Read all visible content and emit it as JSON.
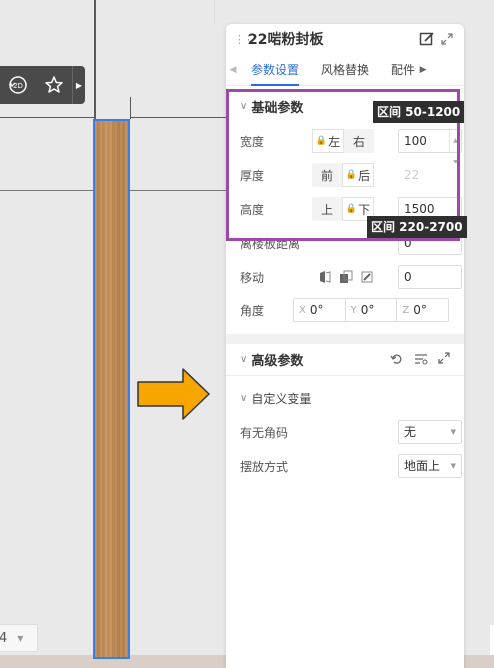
{
  "canvas": {
    "colors": {
      "board_outline": "#3a7ee8",
      "highlight_border": "#9b4aa8",
      "arrow_fill": "#f7a600",
      "accent": "#2a6fd8"
    }
  },
  "mini_toolbar": {
    "icons": [
      "rotate-2d-icon",
      "star-icon",
      "expand-arrow-icon"
    ],
    "rotate_label": "2D"
  },
  "bottom_select": {
    "value": "4"
  },
  "panel": {
    "title": "22啱粉封板",
    "tabs": [
      {
        "label": "参数设置",
        "active": true
      },
      {
        "label": "风格替换",
        "active": false
      },
      {
        "label": "配件仓",
        "active": false
      }
    ],
    "basic": {
      "title": "基础参数",
      "width": {
        "label": "宽度",
        "opt_a": "左",
        "opt_b": "右",
        "value": "100"
      },
      "thickness": {
        "label": "厚度",
        "opt_a": "前",
        "opt_b": "后",
        "value": "22"
      },
      "height": {
        "label": "高度",
        "opt_a": "上",
        "opt_b": "下",
        "value": "1500"
      },
      "ground_distance": {
        "label": "离楼板距离",
        "value": "0"
      },
      "move": {
        "label": "移动",
        "value": "0"
      },
      "angle": {
        "label": "角度",
        "x_axis": "X",
        "x": "0°",
        "y_axis": "Y",
        "y": "0°",
        "z_axis": "Z",
        "z": "0°"
      }
    },
    "advanced": {
      "title": "高级参数",
      "custom_vars_title": "自定义变量",
      "corner_code": {
        "label": "有无角码",
        "value": "无"
      },
      "placement": {
        "label": "摆放方式",
        "value": "地面上"
      }
    }
  },
  "tooltips": {
    "width_range": "区间 50-1200",
    "height_range": "区间 220-2700"
  }
}
